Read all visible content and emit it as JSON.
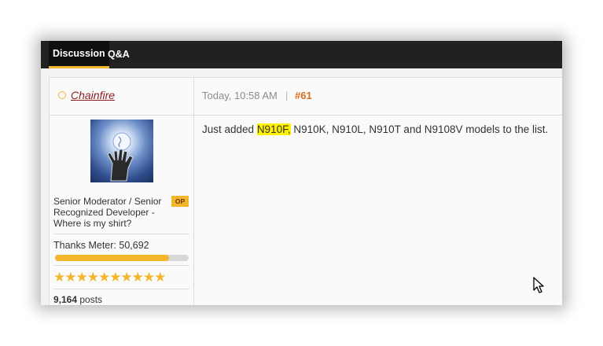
{
  "tabs": [
    {
      "label": "Discussion",
      "active": true
    },
    {
      "label": "Q&A",
      "active": false
    }
  ],
  "post": {
    "username": "Chainfire",
    "date": "Today, 10:58 AM",
    "separator": "|",
    "number": "#61",
    "content_prefix": "Just added ",
    "content_highlight": "N910F,",
    "content_suffix": " N910K, N910L, N910T and N9108V models to the list."
  },
  "user": {
    "title": "Senior Moderator / Senior Recognized Developer - Where is my shirt?",
    "badge": "OP",
    "thanks_meter": "Thanks Meter: 50,692",
    "thanks_fill_fraction": 0.85,
    "stars": "★★★★★★★★★★",
    "post_count": "9,164",
    "posts_label": " posts"
  },
  "colors": {
    "accent": "#f2b52b",
    "username": "#8b1d1d",
    "post_number": "#d76e1f",
    "highlight": "#fff200",
    "tabbar": "#212121"
  },
  "icons": {
    "status": "online-status-icon",
    "cursor": "mouse-pointer-icon",
    "avatar": "hand-globe-avatar"
  }
}
